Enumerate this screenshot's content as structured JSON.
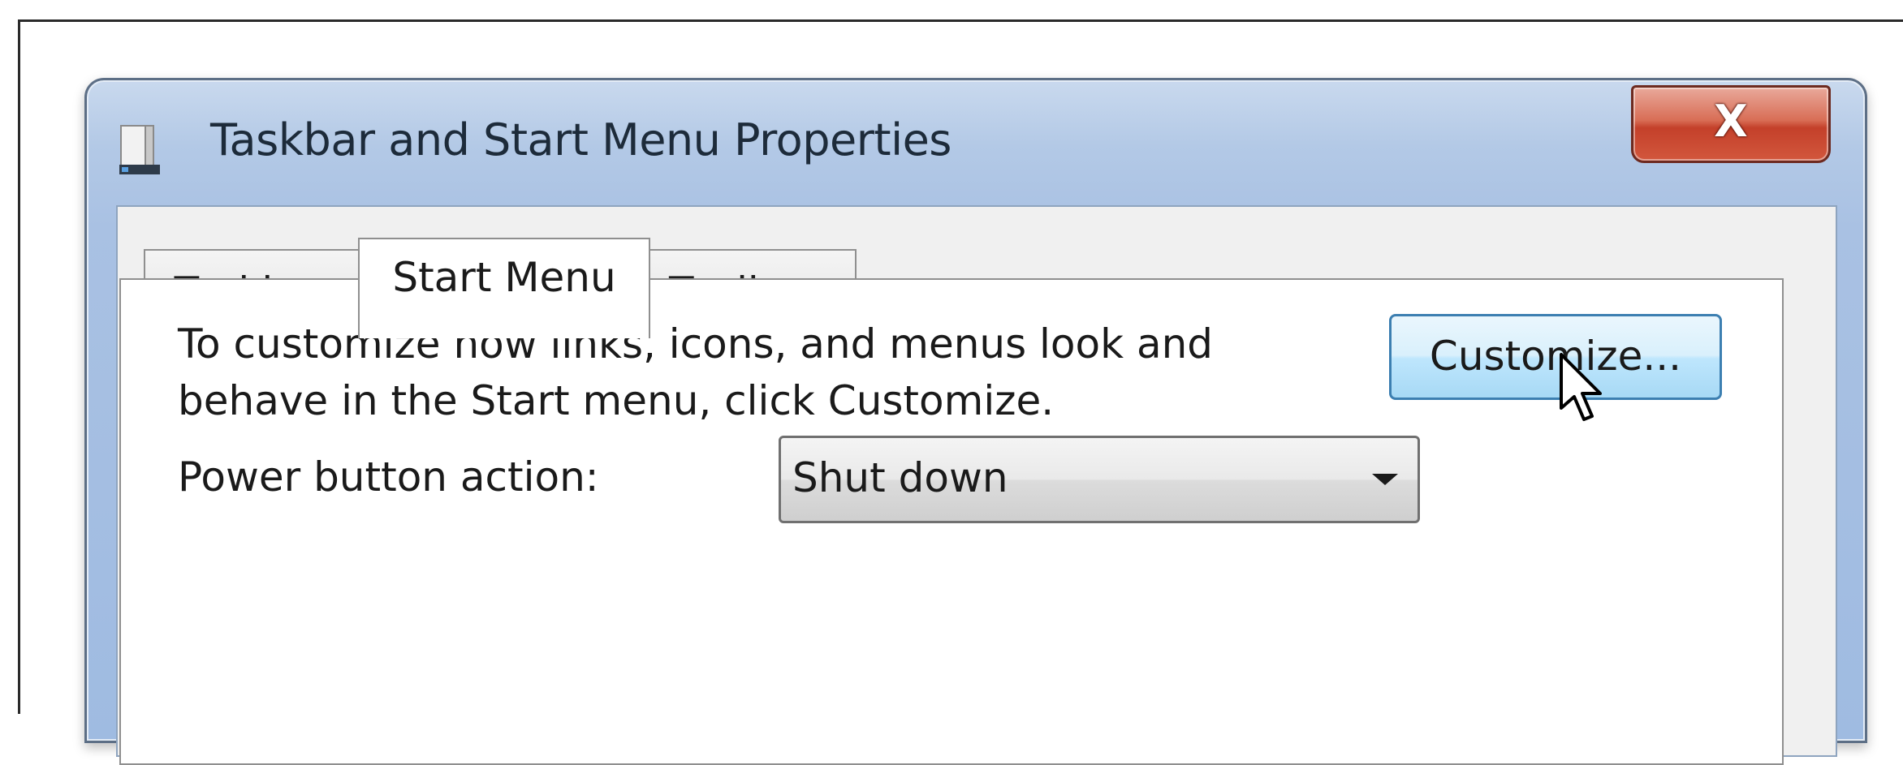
{
  "window": {
    "title": "Taskbar and Start Menu Properties",
    "close_label": "X",
    "title_icon": "taskbar-icon",
    "close_icon": "close-icon"
  },
  "tabs": [
    {
      "label": "Taskbar",
      "active": false
    },
    {
      "label": "Start Menu",
      "active": true
    },
    {
      "label": "Toolbars",
      "active": false
    }
  ],
  "start_menu": {
    "description": "To customize how links, icons, and menus look and behave in the Start menu, click Customize.",
    "customize_label": "Customize...",
    "power_label": "Power button action:",
    "power_value": "Shut down",
    "dropdown_icon": "chevron-down-icon"
  },
  "colors": {
    "title_bar": "#a9c1e3",
    "close_button": "#c4402a",
    "customize_hover": "#bee6fd"
  }
}
